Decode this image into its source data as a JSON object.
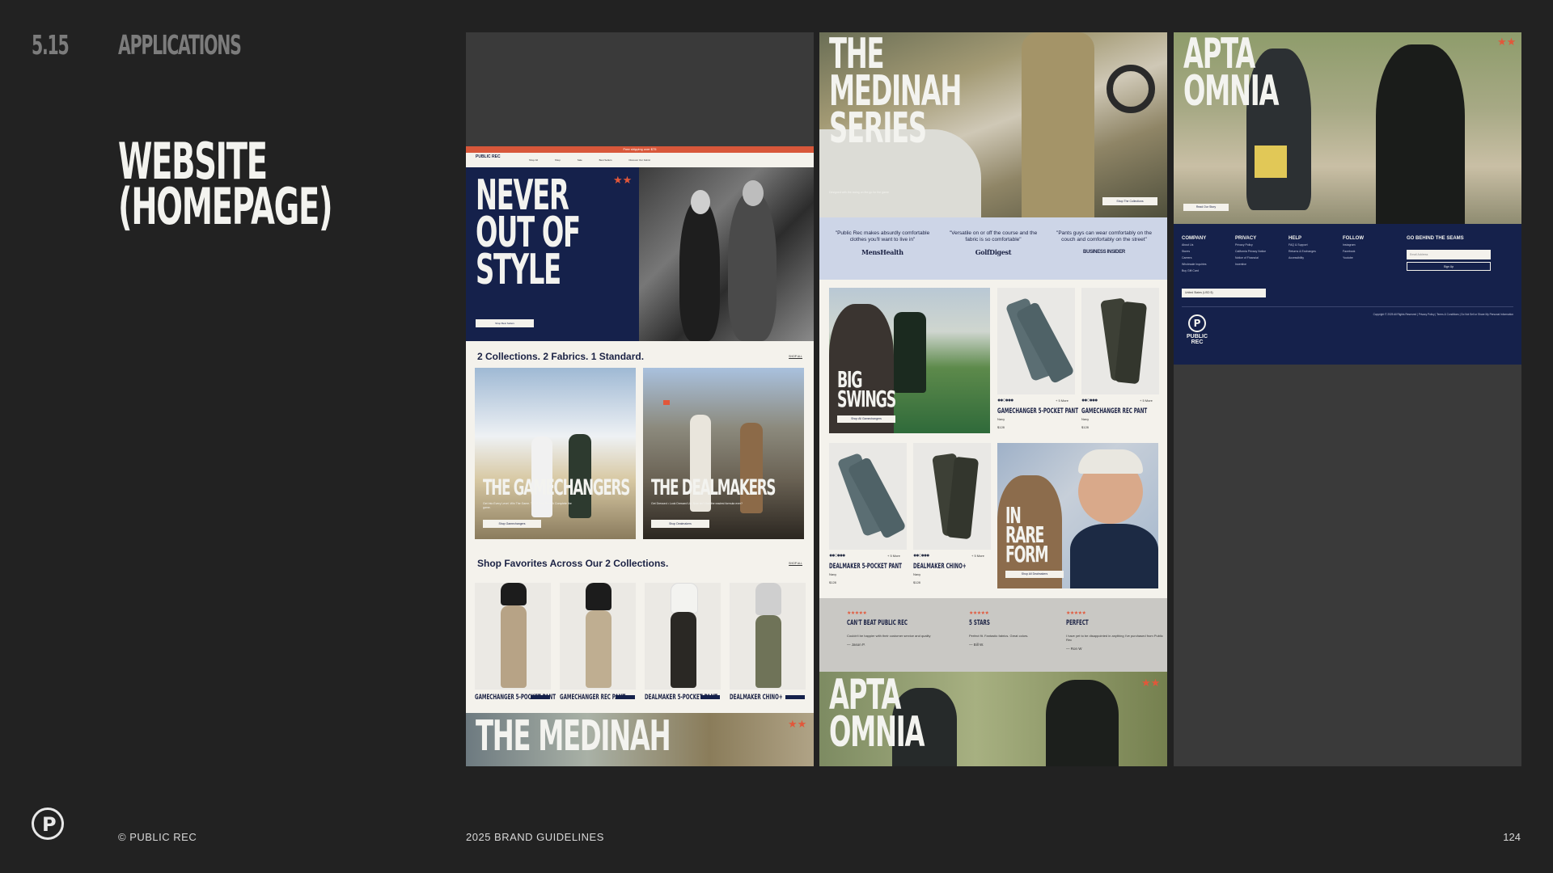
{
  "header": {
    "section_number": "5.15",
    "section_name": "APPLICATIONS"
  },
  "page_title": {
    "line1": "WEBSITE",
    "line2": "(HOMEPAGE)"
  },
  "footer": {
    "copyright": "© PUBLIC REC",
    "guide": "2025 BRAND GUIDELINES",
    "page_number": "124"
  },
  "site": {
    "brand": "PUBLIC REC",
    "announcement": "Free shipping over $75",
    "nav": [
      "Shop All",
      "Shop",
      "Sale",
      "Best Sellers",
      "Discover Our Fabric"
    ],
    "hero": {
      "title": [
        "NEVER",
        "OUT OF",
        "STYLE"
      ],
      "stars": "★★",
      "button": "Shop Best Sellers"
    },
    "collections": {
      "heading": "2 Collections. 2 Fabrics. 1 Standard.",
      "shop_all": "SHOP ALL",
      "cards": [
        {
          "title": "THE GAMECHANGERS",
          "sub": "Get Into Every Level. Win The Game. The 4-Way Stretch Complete the game.",
          "button": "Shop Gamechangers"
        },
        {
          "title": "THE DEALMAKERS",
          "sub": "Get Dressed • Look Dressed Up. Now isn't that the easiest formula ever?",
          "button": "Shop Dealmakers"
        }
      ]
    },
    "favorites": {
      "heading": "Shop Favorites Across Our 2 Collections.",
      "shop_all": "SHOP ALL",
      "products": [
        "GAMECHANGER 5-POCKET PANT",
        "GAMECHANGER REC PANT",
        "DEALMAKER 5-POCKET PANT",
        "DEALMAKER CHINO+"
      ]
    },
    "next_title": "THE MEDINAH",
    "medinah": {
      "title": [
        "THE",
        "MEDINAH",
        "SERIES"
      ],
      "text": "Designed with the swing on the go for the game",
      "button": "Shop The Collections"
    },
    "press": [
      {
        "quote": "\"Public Rec makes absurdly comfortable clothes you'll want to live in\"",
        "pub": "MensHealth"
      },
      {
        "quote": "\"Versatile on or off the course and the fabric is so comfortable\"",
        "pub": "GolfDigest"
      },
      {
        "quote": "\"Pants guys can wear comfortably on the couch and comfortably on the street\"",
        "pub": "BUSINESS INSIDER"
      }
    ],
    "big_swings": {
      "title": [
        "BIG",
        "SWINGS"
      ],
      "button": "Shop All Gamechangers"
    },
    "in_rare_form": {
      "title": [
        "IN",
        "RARE",
        "FORM"
      ],
      "button": "Shop All Dealmakers"
    },
    "grid_products": [
      {
        "name": "GAMECHANGER 5-POCKET PANT",
        "color": "Navy",
        "price": "$128",
        "more": "+ 5 More"
      },
      {
        "name": "GAMECHANGER REC PANT",
        "color": "Navy",
        "price": "$128",
        "more": "+ 5 More"
      },
      {
        "name": "DEALMAKER 5-POCKET PANT",
        "color": "Navy",
        "price": "$128",
        "more": "+ 5 More"
      },
      {
        "name": "DEALMAKER CHINO+",
        "color": "Navy",
        "price": "$128",
        "more": "+ 5 More"
      }
    ],
    "reviews": [
      {
        "stars": "★★★★★",
        "title": "CAN'T BEAT PUBLIC REC",
        "body": "Couldn't be happier with their customer service and quality",
        "name": "— Jason P."
      },
      {
        "stars": "★★★★★",
        "title": "5 STARS",
        "body": "Perfect fit. Fantastic fabrics. Great colors.",
        "name": "— Bill W."
      },
      {
        "stars": "★★★★★",
        "title": "PERFECT",
        "body": "I have yet to be disappointed in anything I've purchased from Public Rec",
        "name": "— Ron W"
      }
    ],
    "apta": {
      "title": [
        "APTA",
        "OMNIA"
      ],
      "button": "Read Our Story"
    },
    "site_footer": {
      "columns": [
        {
          "heading": "COMPANY",
          "links": [
            "About Us",
            "Stores",
            "Careers",
            "Wholesale Inquiries",
            "Buy Gift Card"
          ]
        },
        {
          "heading": "PRIVACY",
          "links": [
            "Privacy Policy",
            "California Privacy Notice",
            "Notice of Financial",
            "Incentive"
          ]
        },
        {
          "heading": "HELP",
          "links": [
            "FAQ & Support",
            "Returns & Exchanges",
            "Accessibility"
          ]
        },
        {
          "heading": "FOLLOW",
          "links": [
            "Instagram",
            "Facebook",
            "Youtube"
          ]
        }
      ],
      "signup_heading": "GO BEHIND THE SEAMS",
      "email_placeholder": "Email Address",
      "signup_button": "Sign Up",
      "country": "United States (USD $)",
      "legal": "Copyright © 2025 All Rights Reserved  |  Privacy Policy  |  Terms & Conditions  |  Do Not Sell or Share My Personal Information"
    }
  },
  "colors": {
    "page_bg": "#222222",
    "navy": "#15214b",
    "accent": "#e2573a",
    "cream": "#f4f2ec",
    "press_blue": "#cdd5e7"
  }
}
